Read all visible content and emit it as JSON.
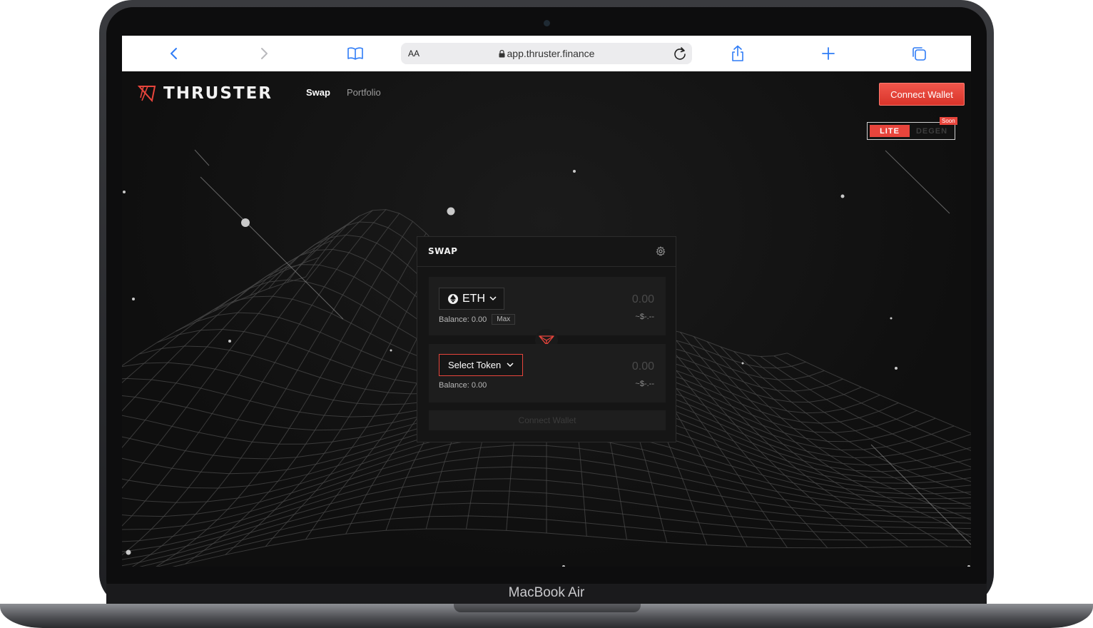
{
  "device": {
    "label": "MacBook Air"
  },
  "browser": {
    "text_size_label": "AA",
    "url": "app.thruster.finance",
    "icons": [
      "back-icon",
      "forward-icon",
      "bookmarks-icon",
      "lock-icon",
      "reload-icon",
      "share-icon",
      "new-tab-icon",
      "tabs-icon"
    ],
    "accent_color": "#2f7cf6"
  },
  "header": {
    "brand": "THRUSTER",
    "nav": {
      "swap": "Swap",
      "portfolio": "Portfolio"
    },
    "connect_wallet": "Connect Wallet",
    "mode": {
      "lite": "LITE",
      "degen": "DEGEN",
      "soon_badge": "Soon"
    },
    "accent_color": "#e8453c"
  },
  "swap": {
    "title": "SWAP",
    "from": {
      "token": "ETH",
      "amount": "0.00",
      "usd": "~$-.--",
      "balance": "Balance: 0.00",
      "max_label": "Max"
    },
    "to": {
      "token_label": "Select Token",
      "amount": "0.00",
      "usd": "~$-.--",
      "balance": "Balance: 0.00"
    },
    "connect_wallet": "Connect Wallet"
  }
}
